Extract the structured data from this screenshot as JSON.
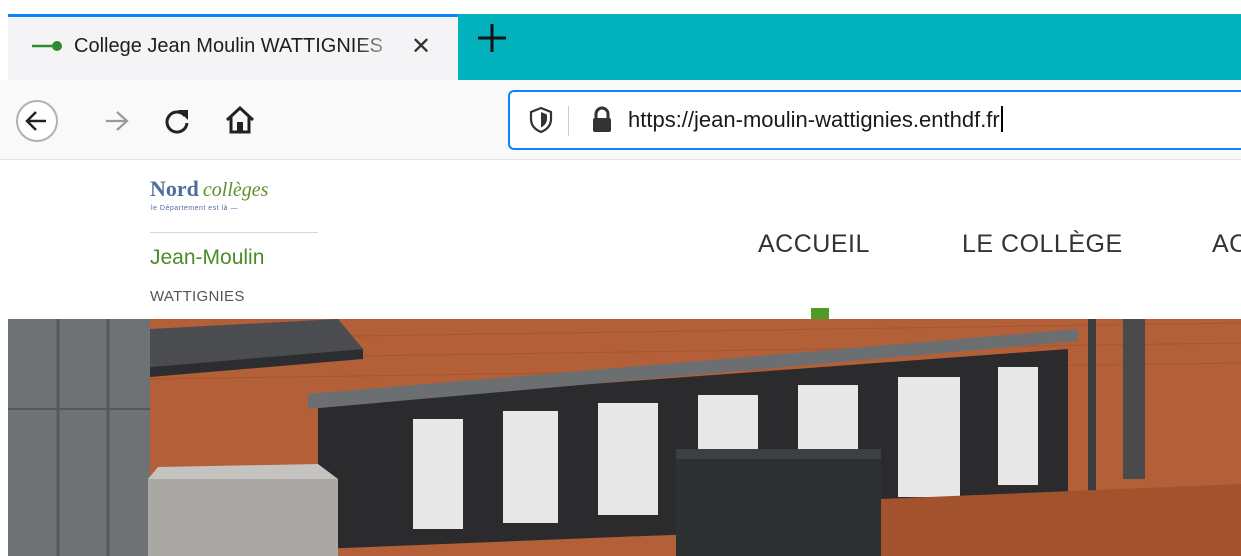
{
  "browser": {
    "tab": {
      "title": "College Jean Moulin WATTIGNIES",
      "close_glyph": "✕"
    },
    "new_tab_icon": "plus-icon",
    "nav_icons": [
      "back-arrow-icon",
      "forward-arrow-icon",
      "reload-icon",
      "home-icon"
    ],
    "url": "https://jean-moulin-wattignies.enthdf.fr",
    "colors": {
      "tabstrip_accent": "#02b2bd",
      "focus": "#0a84ff"
    }
  },
  "site": {
    "logo": {
      "brand": "Nord",
      "brand_suffix": "collèges",
      "tagline": "le Département est là —"
    },
    "school_name": "Jean-Moulin",
    "school_city": "WATTIGNIES",
    "menu": [
      {
        "label": "ACCUEIL"
      },
      {
        "label": "LE COLLÈGE"
      },
      {
        "label": "AC"
      }
    ],
    "colors": {
      "green": "#4d9a26",
      "blue": "#4e6f9c"
    }
  }
}
